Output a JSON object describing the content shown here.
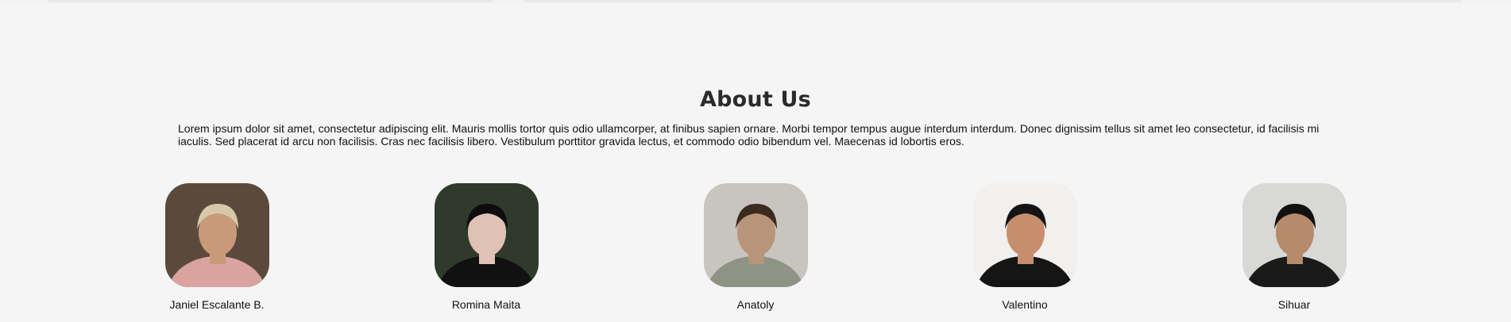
{
  "about": {
    "title": "About Us",
    "description": "Lorem ipsum dolor sit amet, consectetur adipiscing elit. Mauris mollis tortor quis odio ullamcorper, at finibus sapien ornare. Morbi tempor tempus augue interdum interdum. Donec dignissim tellus sit amet leo consectetur, id facilisis mi iaculis. Sed placerat id arcu non facilisis. Cras nec facilisis libero. Vestibulum porttitor gravida lectus, et commodo odio bibendum vel. Maecenas id lobortis eros."
  },
  "team": [
    {
      "name": "Janiel Escalante B.",
      "photo_colors": {
        "background": "#5b4a3c",
        "skin": "#c99a7a",
        "shirt": "#d9a3a0",
        "hair": "#d6c8a8"
      }
    },
    {
      "name": "Romina Maita",
      "photo_colors": {
        "background": "#2f3a2c",
        "skin": "#e0c2b4",
        "shirt": "#111111",
        "hair": "#0d0d0d"
      }
    },
    {
      "name": "Anatoly",
      "photo_colors": {
        "background": "#c8c4be",
        "skin": "#b89478",
        "shirt": "#8e9384",
        "hair": "#3b2a1f"
      }
    },
    {
      "name": "Valentino",
      "photo_colors": {
        "background": "#f2f0ee",
        "skin": "#c68e6c",
        "shirt": "#151515",
        "hair": "#141414"
      }
    },
    {
      "name": "Sihuar",
      "photo_colors": {
        "background": "#d8d8d6",
        "skin": "#b78a6c",
        "shirt": "#1a1a1a",
        "hair": "#111111"
      }
    }
  ]
}
